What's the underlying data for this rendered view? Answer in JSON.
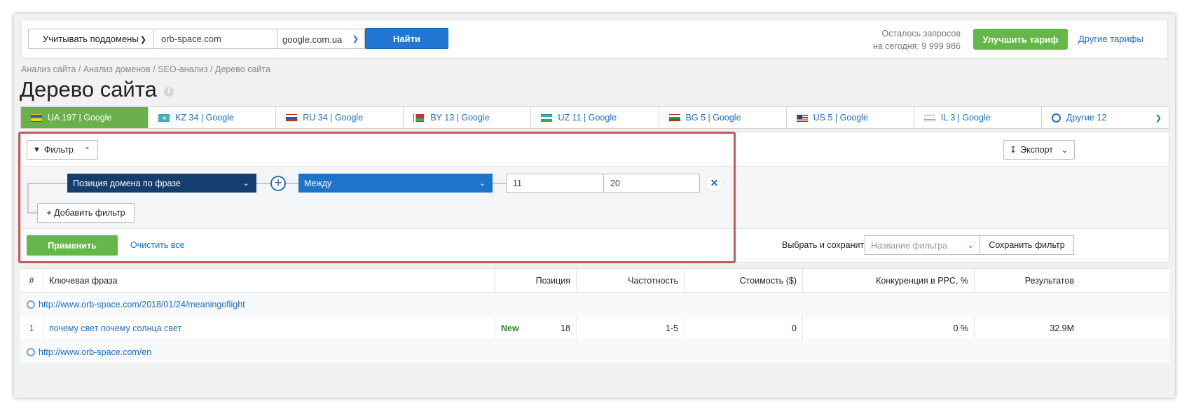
{
  "search": {
    "subdomains_label": "Учитывать поддомены",
    "domain_value": "orb-space.com",
    "engine_value": "google.com.ua",
    "find_label": "Найти"
  },
  "quota": {
    "line1": "Осталось запросов",
    "line2": "на сегодня: 9 999 986"
  },
  "upgrade_label": "Улучшить тариф",
  "other_tariffs_label": "Другие тарифы",
  "breadcrumb": "Анализ сайта / Анализ доменов / SEO-анализ / Дерево сайта",
  "page_title": "Дерево сайта",
  "tabs": [
    {
      "label": "UA 197 | Google",
      "flag": "ua"
    },
    {
      "label": "KZ 34 | Google",
      "flag": "kz"
    },
    {
      "label": "RU 34 | Google",
      "flag": "ru"
    },
    {
      "label": "BY 13 | Google",
      "flag": "by"
    },
    {
      "label": "UZ 11 | Google",
      "flag": "uz"
    },
    {
      "label": "BG 5 | Google",
      "flag": "bg"
    },
    {
      "label": "US 5 | Google",
      "flag": "us"
    },
    {
      "label": "IL 3 | Google",
      "flag": "il"
    },
    {
      "label": "Другие 12",
      "flag": "globe"
    }
  ],
  "filter": {
    "toggle_label": "Фильтр",
    "export_label": "Экспорт",
    "condition_field": "Позиция домена по фразе",
    "condition_operator": "Между",
    "value_from": "11",
    "value_to": "20",
    "add_filter_label": "+ Добавить фильтр",
    "apply_label": "Применить",
    "clear_label": "Очистить все",
    "save_choose_label": "Выбрать и сохранить",
    "filter_name_placeholder": "Название фильтра",
    "save_filter_label": "Сохранить фильтр"
  },
  "table": {
    "headers": [
      "#",
      "Ключевая фраза",
      "Позиция",
      "Частотность",
      "Стоимость ($)",
      "Конкуренция в PPC, %",
      "Результатов"
    ],
    "groups": [
      {
        "url": "http://www.orb-space.com/2018/01/24/meaningoflight",
        "rows": [
          {
            "num": "1",
            "keyword": "почему свет почему солнца свет",
            "badge": "New",
            "position": "18",
            "frequency": "1-5",
            "cost": "0",
            "competition": "0 %",
            "results": "32.9M"
          }
        ]
      },
      {
        "url": "http://www.orb-space.com/en",
        "rows": []
      }
    ]
  },
  "colors": {
    "accent_blue": "#2277d4",
    "green": "#66b749",
    "dark_blue": "#153d6e",
    "highlight_red": "#c75a5e"
  }
}
